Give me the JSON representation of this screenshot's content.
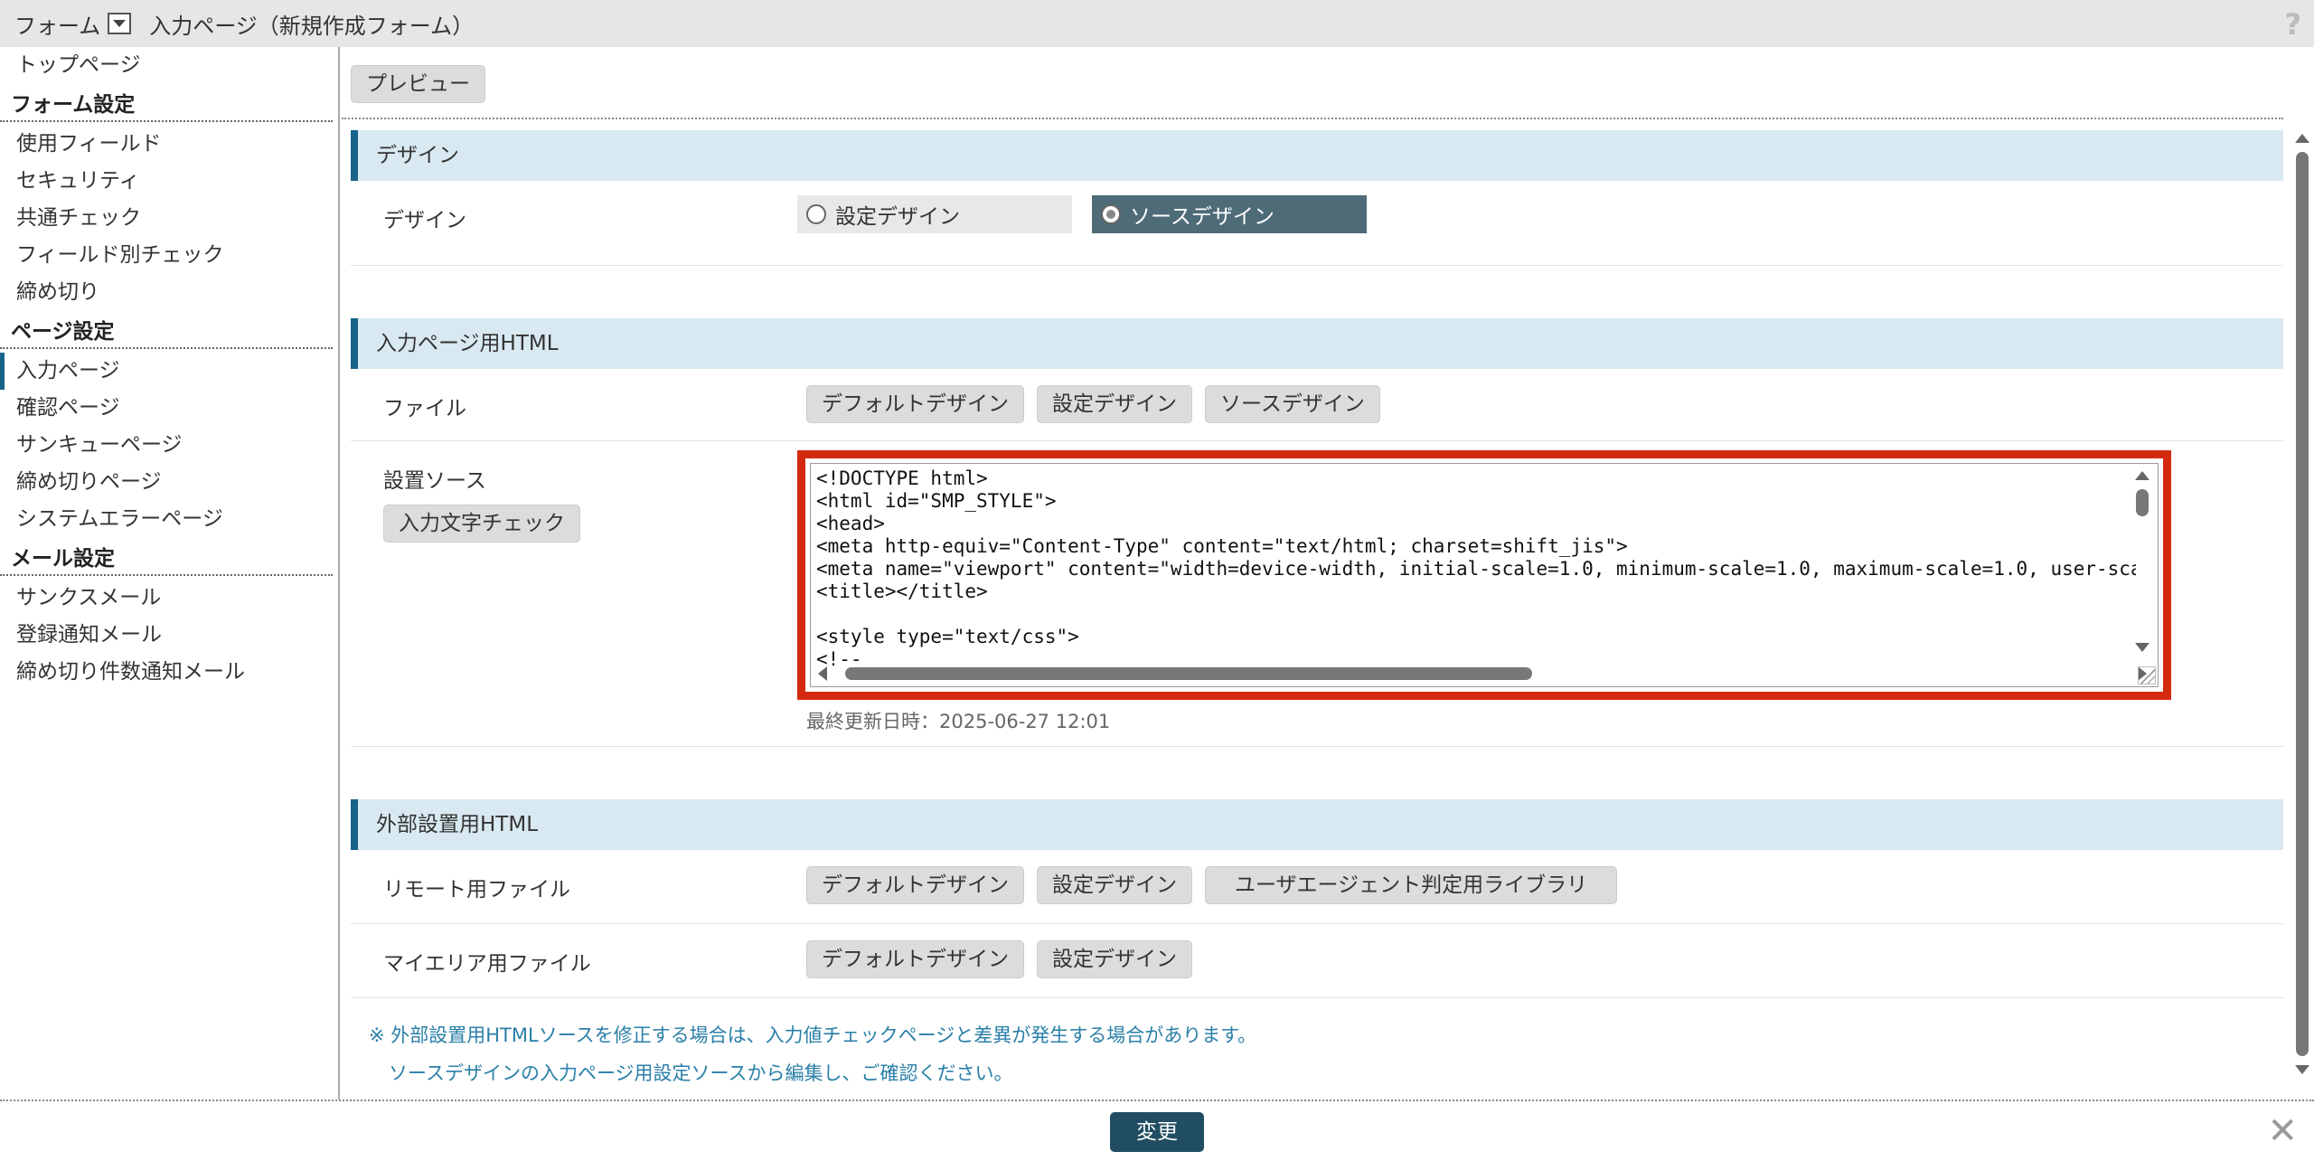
{
  "topbar": {
    "menu_label": "フォーム",
    "page_title": "入力ページ（新規作成フォーム）",
    "help": "?"
  },
  "sidebar": {
    "top": "トップページ",
    "groups": [
      {
        "heading": "フォーム設定",
        "items": [
          "使用フィールド",
          "セキュリティ",
          "共通チェック",
          "フィールド別チェック",
          "締め切り"
        ]
      },
      {
        "heading": "ページ設定",
        "items": [
          "入力ページ",
          "確認ページ",
          "サンキューページ",
          "締め切りページ",
          "システムエラーページ"
        ],
        "active": "入力ページ"
      },
      {
        "heading": "メール設定",
        "items": [
          "サンクスメール",
          "登録通知メール",
          "締め切り件数通知メール"
        ]
      }
    ]
  },
  "main": {
    "preview_button": "プレビュー",
    "design_section": {
      "title": "デザイン",
      "label": "デザイン",
      "options": [
        "設定デザイン",
        "ソースデザイン"
      ],
      "selected": "ソースデザイン"
    },
    "input_html_section": {
      "title": "入力ページ用HTML",
      "file_label": "ファイル",
      "file_buttons": [
        "デフォルトデザイン",
        "設定デザイン",
        "ソースデザイン"
      ],
      "source_label": "設置ソース",
      "check_button": "入力文字チェック",
      "source_code": "<!DOCTYPE html>\n<html id=\"SMP_STYLE\">\n<head>\n<meta http-equiv=\"Content-Type\" content=\"text/html; charset=shift_jis\">\n<meta name=\"viewport\" content=\"width=device-width, initial-scale=1.0, minimum-scale=1.0, maximum-scale=1.0, user-sca\n<title></title>\n\n<style type=\"text/css\">\n<!--",
      "last_updated": "最終更新日時：2025-06-27 12:01"
    },
    "external_section": {
      "title": "外部設置用HTML",
      "remote_label": "リモート用ファイル",
      "remote_buttons": [
        "デフォルトデザイン",
        "設定デザイン",
        "ユーザエージェント判定用ライブラリ"
      ],
      "myarea_label": "マイエリア用ファイル",
      "myarea_buttons": [
        "デフォルトデザイン",
        "設定デザイン"
      ]
    },
    "notes": [
      "※ 外部設置用HTMLソースを修正する場合は、入力値チェックページと差異が発生する場合があります。",
      "ソースデザインの入力ページ用設定ソースから編集し、ご確認ください。"
    ]
  },
  "footer": {
    "submit_button": "変更",
    "close": "✕"
  },
  "colors": {
    "accent": "#17638a",
    "section_bg": "#d9e9f1",
    "highlight_border": "#d42a10",
    "submit_bg": "#214d62",
    "note_text": "#2a7fa8"
  }
}
